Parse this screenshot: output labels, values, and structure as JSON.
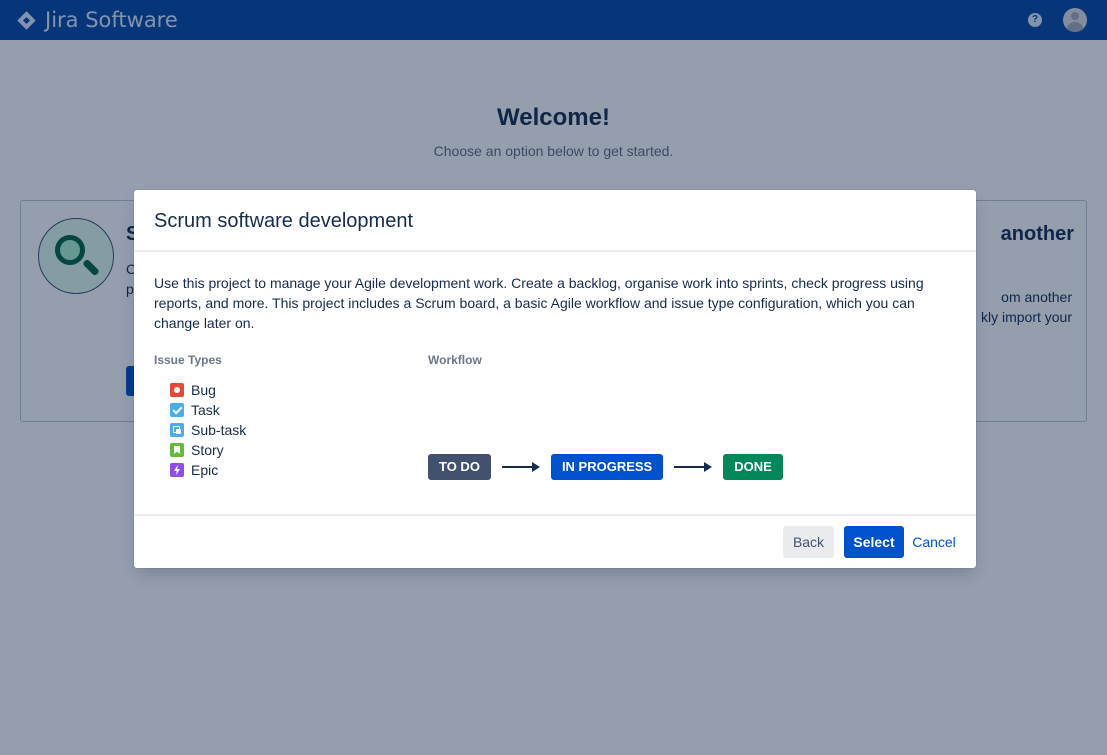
{
  "topbar": {
    "product_name": "Jira Software",
    "help_glyph": "?"
  },
  "welcome": {
    "title": "Welcome!",
    "subtitle": "Choose an option below to get started."
  },
  "background_cards": {
    "left": {
      "title_fragment": "S",
      "text_line1": "C",
      "text_line2": "p"
    },
    "right": {
      "title_fragment": "another",
      "text_line1": "om another",
      "text_line2": "kly import your"
    }
  },
  "modal": {
    "title": "Scrum software development",
    "description": "Use this project to manage your Agile development work. Create a backlog, organise work into sprints, check progress using reports, and more. This project includes a Scrum board, a basic Agile workflow and issue type configuration, which you can change later on.",
    "issue_types_label": "Issue Types",
    "issue_types": [
      {
        "label": "Bug",
        "icon": "bug-icon",
        "color": "#e5493a"
      },
      {
        "label": "Task",
        "icon": "task-icon",
        "color": "#4bade8"
      },
      {
        "label": "Sub-task",
        "icon": "subtask-icon",
        "color": "#4bade8"
      },
      {
        "label": "Story",
        "icon": "story-icon",
        "color": "#63ba3c"
      },
      {
        "label": "Epic",
        "icon": "epic-icon",
        "color": "#904ee2"
      }
    ],
    "workflow_label": "Workflow",
    "workflow": [
      {
        "label": "TO DO",
        "color": "#42526e"
      },
      {
        "label": "IN PROGRESS",
        "color": "#0052cc"
      },
      {
        "label": "DONE",
        "color": "#00875a"
      }
    ],
    "buttons": {
      "back": "Back",
      "select": "Select",
      "cancel": "Cancel"
    }
  },
  "colors": {
    "topbar": "#0747a6",
    "primary": "#0052cc",
    "text": "#172b4d"
  }
}
